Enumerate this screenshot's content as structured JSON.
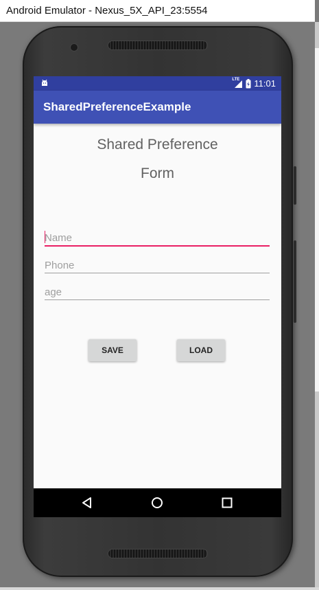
{
  "window": {
    "title": "Android Emulator - Nexus_5X_API_23:5554"
  },
  "status_bar": {
    "left_icon": "android-notification-icon",
    "signal_label": "LTE",
    "battery_icon": "battery-charging-icon",
    "time": "11:01"
  },
  "app_bar": {
    "title": "SharedPreferenceExample"
  },
  "form": {
    "heading_line1": "Shared Preference",
    "heading_line2": "Form",
    "fields": [
      {
        "placeholder": "Name",
        "value": "",
        "focused": true
      },
      {
        "placeholder": "Phone",
        "value": ""
      },
      {
        "placeholder": "age",
        "value": ""
      }
    ],
    "save_label": "SAVE",
    "load_label": "LOAD"
  },
  "nav_bar": {
    "back_icon": "back-icon",
    "home_icon": "home-icon",
    "recents_icon": "recents-icon"
  },
  "colors": {
    "status_bar": "#303f9f",
    "app_bar": "#3f51b5",
    "accent": "#e91e63",
    "screen_bg": "#fafafa"
  }
}
